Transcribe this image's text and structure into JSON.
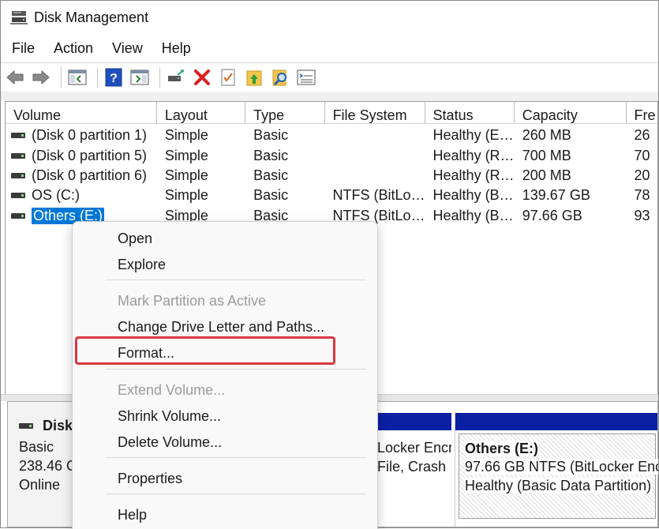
{
  "window": {
    "title": "Disk Management"
  },
  "menubar": [
    "File",
    "Action",
    "View",
    "Help"
  ],
  "toolbar": {
    "buttons": [
      "back-arrow-icon",
      "forward-arrow-icon",
      "console-tree-icon",
      "help-icon",
      "action-pane-icon",
      "connect-drive-icon",
      "delete-icon",
      "properties-icon",
      "up-folder-icon",
      "search-icon",
      "settings-list-icon"
    ],
    "colors": {
      "delete": "#d91f1f",
      "help": "#1f4fbf",
      "folder": "#f3c64a"
    }
  },
  "table": {
    "columns": [
      "Volume",
      "Layout",
      "Type",
      "File System",
      "Status",
      "Capacity",
      "Fre"
    ],
    "rows": [
      {
        "volume": "(Disk 0 partition 1)",
        "layout": "Simple",
        "type": "Basic",
        "fs": "",
        "status": "Healthy (E…",
        "capacity": "260 MB",
        "free": "26"
      },
      {
        "volume": "(Disk 0 partition 5)",
        "layout": "Simple",
        "type": "Basic",
        "fs": "",
        "status": "Healthy (R…",
        "capacity": "700 MB",
        "free": "70"
      },
      {
        "volume": "(Disk 0 partition 6)",
        "layout": "Simple",
        "type": "Basic",
        "fs": "",
        "status": "Healthy (R…",
        "capacity": "200 MB",
        "free": "20"
      },
      {
        "volume": "OS (C:)",
        "layout": "Simple",
        "type": "Basic",
        "fs": "NTFS (BitLo…",
        "status": "Healthy (B…",
        "capacity": "139.67 GB",
        "free": "78"
      },
      {
        "volume": "Others (E:)",
        "layout": "Simple",
        "type": "Basic",
        "fs": "NTFS (BitLo…",
        "status": "Healthy (B…",
        "capacity": "97.66 GB",
        "free": "93"
      }
    ]
  },
  "disk": {
    "name": "Disk",
    "type": "Basic",
    "size": "238.46 G",
    "state": "Online",
    "partition_a_lines": [
      "Locker Encr",
      "File, Crash"
    ],
    "partition_b": {
      "title": "Others  (E:)",
      "line1": "97.66 GB NTFS (BitLocker Encr",
      "line2": "Healthy (Basic Data Partition)"
    }
  },
  "context_menu": {
    "items": [
      {
        "label": "Open",
        "disabled": false
      },
      {
        "label": "Explore",
        "disabled": false
      },
      {
        "label": "Mark Partition as Active",
        "disabled": true
      },
      {
        "label": "Change Drive Letter and Paths...",
        "disabled": false
      },
      {
        "label": "Format...",
        "disabled": false,
        "highlighted": true
      },
      {
        "label": "Extend Volume...",
        "disabled": true
      },
      {
        "label": "Shrink Volume...",
        "disabled": false
      },
      {
        "label": "Delete Volume...",
        "disabled": false
      },
      {
        "label": "Properties",
        "disabled": false
      },
      {
        "label": "Help",
        "disabled": false
      }
    ],
    "highlight_color": "#d9393f"
  },
  "selection_color": "#0078d7"
}
